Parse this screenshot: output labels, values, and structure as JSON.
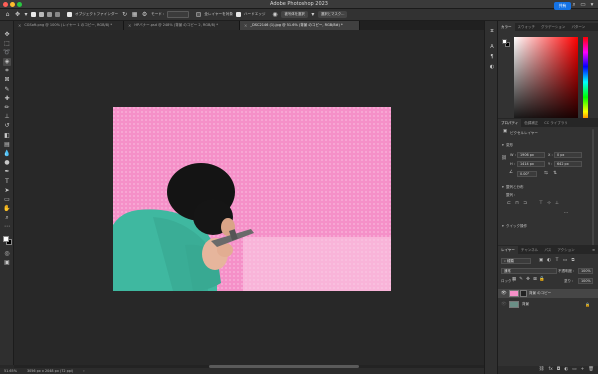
{
  "window": {
    "title": "Adobe Photoshop 2023"
  },
  "options_bar": {
    "auto_select_label": "オブジェクトファインダー",
    "mode_label": "モード :",
    "mode_value": "",
    "layer_select_label": "全レイヤーを対象",
    "hard_edge_label": "ハードエッジ",
    "select_subject_label": "被写体を選択",
    "select_and_mask_label": "選択とマスク...",
    "share_label": "共有"
  },
  "tabs": [
    {
      "label": "CGSoft.png @ 100% (レイヤー 1 のコピー, RGB/8) *",
      "active": false
    },
    {
      "label": "HPバナー.psd @ 248% (背景 のコピー 2, RGB/8) *",
      "active": false
    },
    {
      "label": "_DSC2146 (1).jpg @ 51.6% (背景 のコピー, RGB/8#) *",
      "active": true
    }
  ],
  "status": {
    "zoom": "51.65%",
    "doc_info": "3056 px x 2048 px (72 ppi)"
  },
  "color_panel": {
    "tabs": [
      "カラー",
      "スウォッチ",
      "グラデーション",
      "パターン"
    ]
  },
  "properties_panel": {
    "tabs": [
      "プロパティ",
      "色調補正",
      "CC ライブラリ"
    ],
    "layer_type": "ピクセルレイヤー",
    "transform_label": "変形",
    "w_label": "W :",
    "w_value": "1906 px",
    "h_label": "H :",
    "h_value": "1414 px",
    "x_label": "X :",
    "x_value": "0 px",
    "y_label": "Y :",
    "y_value": "642 px",
    "angle_value": "0.00°",
    "align_label": "整列と分布",
    "align_sub": "整列 :",
    "quick_actions_label": "クイック操作"
  },
  "layers_panel": {
    "tabs": [
      "レイヤー",
      "チャンネル",
      "パス",
      "アクション"
    ],
    "kind_label": "種類",
    "blend_mode": "通常",
    "opacity_label": "不透明度 :",
    "opacity_value": "100%",
    "lock_label": "ロック :",
    "fill_label": "塗り :",
    "fill_value": "100%",
    "layers": [
      {
        "name": "背景 のコピー",
        "selected": true
      },
      {
        "name": "背景",
        "selected": false
      }
    ]
  },
  "colors": {
    "canvas_pink": "#f590c8",
    "shirt_teal": "#3fb8a0",
    "accent_blue": "#1473e6"
  }
}
